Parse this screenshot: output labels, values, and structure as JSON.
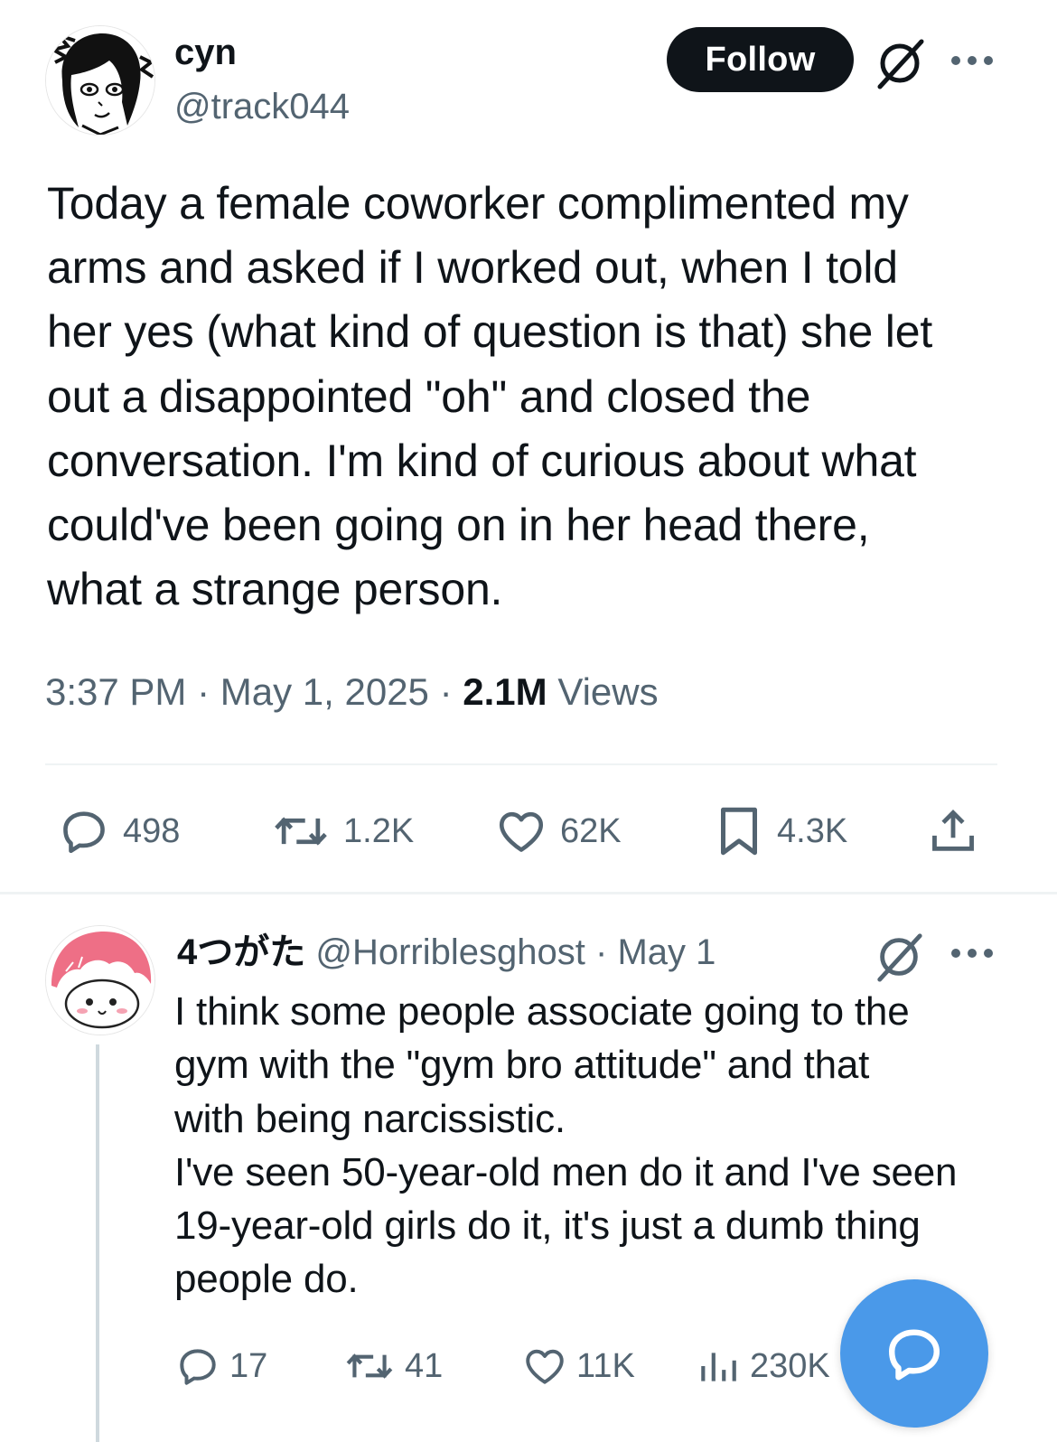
{
  "tweet": {
    "author": {
      "display_name": "cyn",
      "handle": "@track044",
      "avatar_icon": "manga-portrait-avatar"
    },
    "follow_label": "Follow",
    "text": "Today a female coworker complimented my\narms and asked if I worked out, when I told\nher yes (what kind of question is that) she let\nout a disappointed \"oh\" and closed the\nconversation. I'm kind of curious about what\ncould've been going on in her head there,\nwhat a strange person.",
    "time": "3:37 PM",
    "date": "May 1, 2025",
    "views_count": "2.1M",
    "views_label": "Views",
    "actions": {
      "replies": "498",
      "reposts": "1.2K",
      "likes": "62K",
      "bookmarks": "4.3K"
    }
  },
  "reply": {
    "author": {
      "display_name": "4つがた",
      "handle": "@Horriblesghost",
      "avatar_icon": "pink-haired-chibi-avatar"
    },
    "date": "May 1",
    "text": "I think some people associate going to the\ngym with the \"gym bro attitude\" and that\nwith being narcissistic.\nI've seen 50-year-old men do it and I've seen\n19-year-old girls do it, it's just a dumb thing\npeople do.",
    "actions": {
      "replies": "17",
      "reposts": "41",
      "likes": "11K",
      "views": "230K"
    }
  },
  "separator": "·",
  "colors": {
    "text": "#0f1419",
    "secondary": "#536471",
    "follow_bg": "#0f1419",
    "fab": "#4a99e9",
    "divider": "#eff3f4"
  },
  "icons": [
    "grok-icon",
    "more-icon",
    "reply-icon",
    "repost-icon",
    "like-icon",
    "bookmark-icon",
    "share-icon",
    "views-icon",
    "compose-reply-icon"
  ]
}
